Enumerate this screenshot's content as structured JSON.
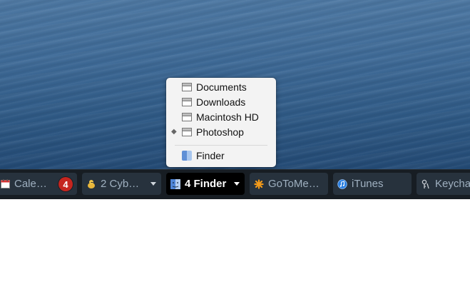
{
  "menu": {
    "items": [
      {
        "label": "Documents",
        "marked": false
      },
      {
        "label": "Downloads",
        "marked": false
      },
      {
        "label": "Macintosh HD",
        "marked": false
      },
      {
        "label": "Photoshop",
        "marked": true,
        "mark_symbol": "◆"
      }
    ],
    "app_item": {
      "label": "Finder",
      "icon": "finder-icon"
    }
  },
  "taskbar": {
    "items": [
      {
        "label": "Cale…",
        "icon": "calendar-icon",
        "badge": "4"
      },
      {
        "label": "2 Cyb…",
        "icon": "cyberduck-icon",
        "has_dropdown": true
      },
      {
        "label": "4 Finder",
        "icon": "finder-icon",
        "has_dropdown": true,
        "active": true
      },
      {
        "label": "GoToMe…",
        "icon": "gotomeeting-icon"
      },
      {
        "label": "iTunes",
        "icon": "itunes-icon"
      },
      {
        "label": "Keycha",
        "icon": "keychain-icon"
      }
    ]
  },
  "colors": {
    "taskbar_bg": "#171d23",
    "item_bg": "#27323d",
    "active_bg": "#000000",
    "badge_bg": "#c5251f",
    "menu_bg": "#f3f3f3"
  }
}
